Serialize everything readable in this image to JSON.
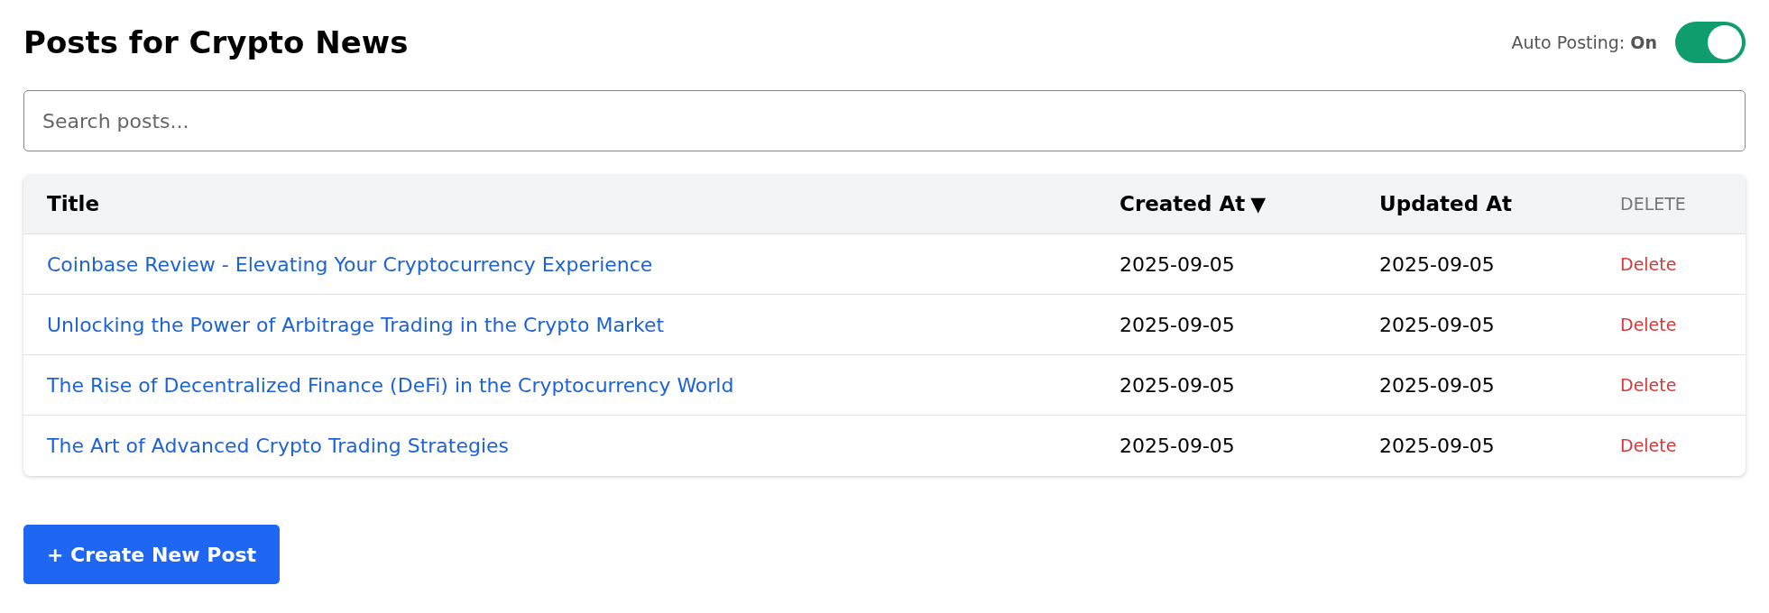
{
  "page": {
    "title": "Posts for Crypto News"
  },
  "auto_posting": {
    "label": "Auto Posting: **On**",
    "on": true
  },
  "search": {
    "placeholder": "Search posts..."
  },
  "table": {
    "columns": [
      {
        "label": "Title",
        "kind": "header"
      },
      {
        "label": "Created At",
        "kind": "header",
        "sort": "▼"
      },
      {
        "label": "Updated At",
        "kind": "header"
      },
      {
        "label": "DELETE",
        "kind": "muted"
      }
    ],
    "rows": [
      {
        "title": "Coinbase Review - Elevating Your Cryptocurrency Experience",
        "created": "2025-09-05",
        "updated": "2025-09-05",
        "action": "Delete"
      },
      {
        "title": "Unlocking the Power of Arbitrage Trading in the Crypto Market",
        "created": "2025-09-05",
        "updated": "2025-09-05",
        "action": "Delete"
      },
      {
        "title": "The Rise of Decentralized Finance (DeFi) in the Cryptocurrency World",
        "created": "2025-09-05",
        "updated": "2025-09-05",
        "action": "Delete"
      },
      {
        "title": "The Art of Advanced Crypto Trading Strategies",
        "created": "2025-09-05",
        "updated": "2025-09-05",
        "action": "Delete"
      }
    ]
  },
  "create_button": {
    "label": "+ Create New Post"
  }
}
